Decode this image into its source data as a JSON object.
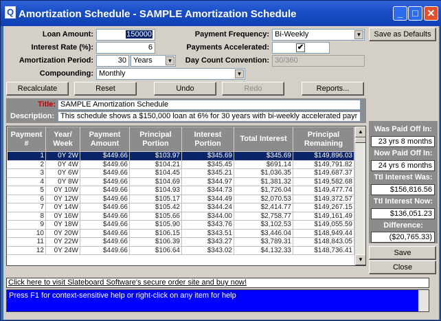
{
  "window": {
    "title": "Amortization Schedule - SAMPLE Amortization Schedule",
    "app_icon": "Q",
    "controls": {
      "minimize": "_",
      "maximize": "□",
      "close": "✕"
    }
  },
  "form": {
    "loan_amount_label": "Loan Amount:",
    "loan_amount_value": "150000",
    "interest_rate_label": "Interest Rate (%):",
    "interest_rate_value": "6",
    "amort_period_label": "Amortization Period:",
    "amort_period_value": "30",
    "amort_period_unit": "Years",
    "compounding_label": "Compounding:",
    "compounding_value": "Monthly",
    "payment_freq_label": "Payment Frequency:",
    "payment_freq_value": "Bi-Weekly",
    "payments_accel_label": "Payments Accelerated:",
    "payments_accel_checked": "✔",
    "day_count_label": "Day Count Convention:",
    "day_count_value": "30/360"
  },
  "buttons": {
    "save_defaults": "Save as Defaults",
    "recalculate": "Recalculate",
    "reset": "Reset",
    "undo": "Undo",
    "redo": "Redo",
    "reports": "Reports...",
    "save": "Save",
    "close": "Close"
  },
  "description": {
    "title_label": "Title:",
    "title_value": "SAMPLE Amortization Schedule",
    "desc_label": "Description:",
    "desc_value": "This schedule shows a $150,000 loan at 6% for 30 years with bi-weekly accelerated payr"
  },
  "table": {
    "headers": [
      "Payment #",
      "Year/ Week",
      "Payment Amount",
      "Principal Portion",
      "Interest Portion",
      "Total Interest",
      "Principal Remaining"
    ],
    "rows": [
      [
        "1",
        "0Y 2W",
        "$449.66",
        "$103.97",
        "$345.69",
        "$345.69",
        "$149,896.03"
      ],
      [
        "2",
        "0Y 4W",
        "$449.66",
        "$104.21",
        "$345.45",
        "$691.14",
        "$149,791.82"
      ],
      [
        "3",
        "0Y 6W",
        "$449.66",
        "$104.45",
        "$345.21",
        "$1,036.35",
        "$149,687.37"
      ],
      [
        "4",
        "0Y 8W",
        "$449.66",
        "$104.69",
        "$344.97",
        "$1,381.32",
        "$149,582.68"
      ],
      [
        "5",
        "0Y 10W",
        "$449.66",
        "$104.93",
        "$344.73",
        "$1,726.04",
        "$149,477.74"
      ],
      [
        "6",
        "0Y 12W",
        "$449.66",
        "$105.17",
        "$344.49",
        "$2,070.53",
        "$149,372.57"
      ],
      [
        "7",
        "0Y 14W",
        "$449.66",
        "$105.42",
        "$344.24",
        "$2,414.77",
        "$149,267.15"
      ],
      [
        "8",
        "0Y 16W",
        "$449.66",
        "$105.66",
        "$344.00",
        "$2,758.77",
        "$149,161.49"
      ],
      [
        "9",
        "0Y 18W",
        "$449.66",
        "$105.90",
        "$343.76",
        "$3,102.53",
        "$149,055.59"
      ],
      [
        "10",
        "0Y 20W",
        "$449.66",
        "$106.15",
        "$343.51",
        "$3,446.04",
        "$148,949.44"
      ],
      [
        "11",
        "0Y 22W",
        "$449.66",
        "$106.39",
        "$343.27",
        "$3,789.31",
        "$148,843.05"
      ],
      [
        "12",
        "0Y 24W",
        "$449.66",
        "$106.64",
        "$343.02",
        "$4,132.33",
        "$148,736.41"
      ]
    ]
  },
  "summary": {
    "was_paid_label": "Was Paid Off In:",
    "was_paid_value": "23 yrs 8 months",
    "now_paid_label": "Now Paid Off In:",
    "now_paid_value": "24 yrs 6 months",
    "ttl_was_label": "Ttl Interest Was:",
    "ttl_was_value": "$156,816.56",
    "ttl_now_label": "Ttl Interest Now:",
    "ttl_now_value": "$136,051.23",
    "diff_label": "Difference:",
    "diff_value": "($20,765.33)"
  },
  "footer": {
    "order_link": "Click here to visit Slateboard Software's secure order site and buy now!",
    "status": "Press F1 for context-sensitive help or right-click on any item for help"
  }
}
